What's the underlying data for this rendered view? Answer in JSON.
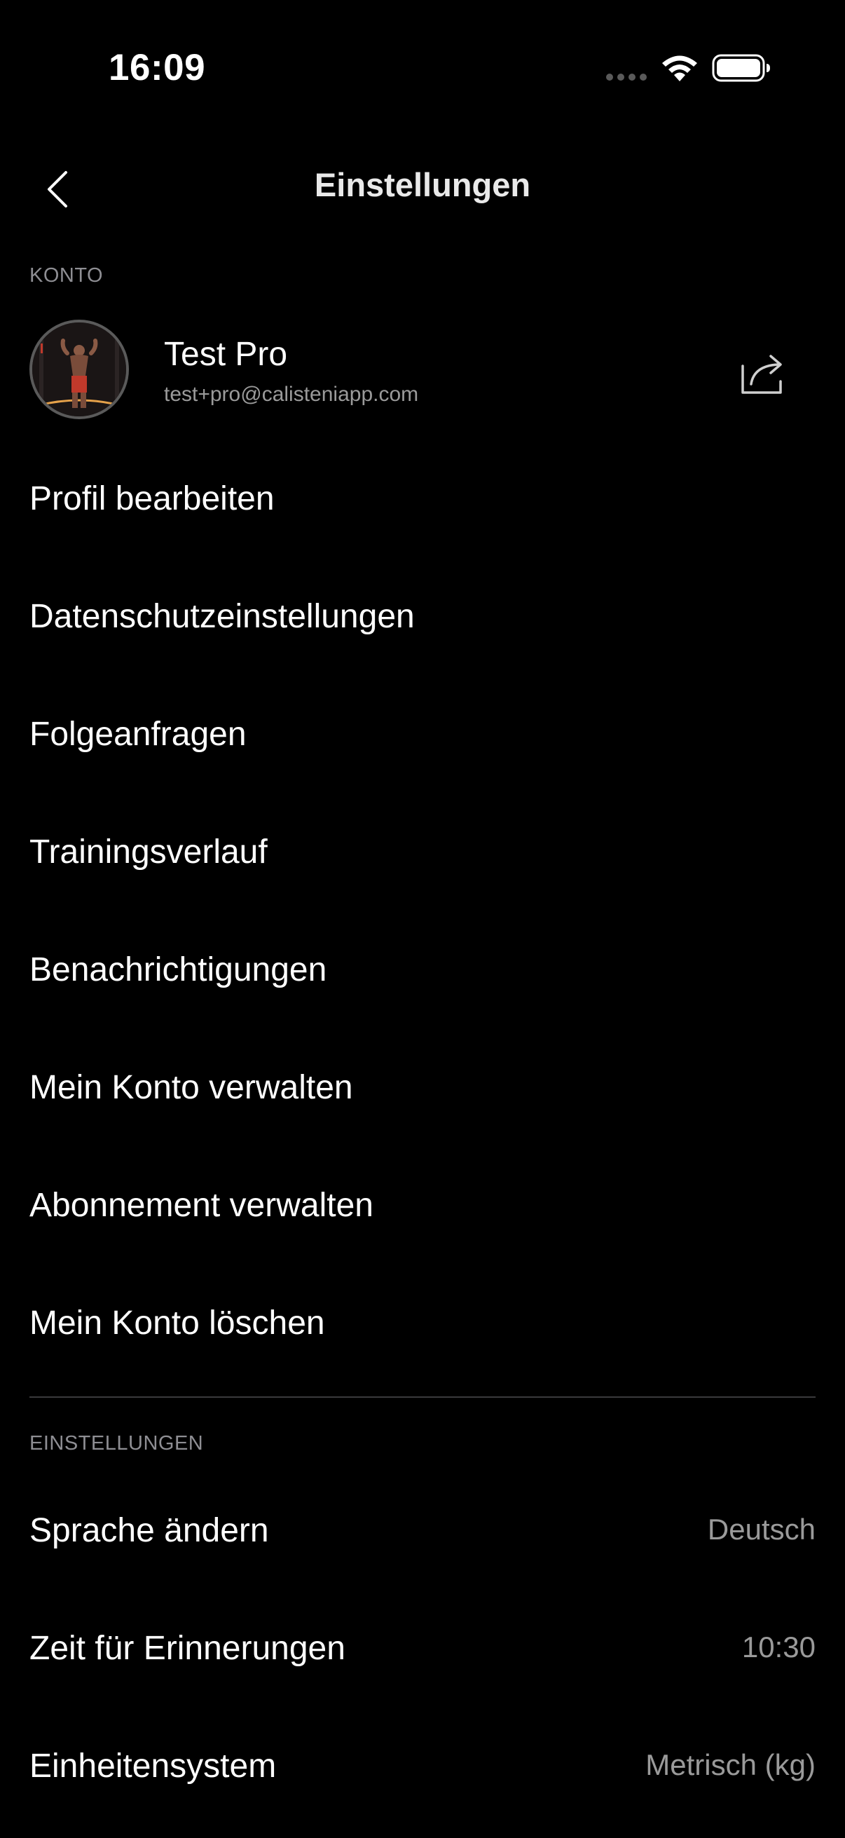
{
  "status_bar": {
    "time": "16:09"
  },
  "nav": {
    "title": "Einstellungen",
    "back_icon": "chevron-left-icon"
  },
  "account_section": {
    "label": "KONTO",
    "profile": {
      "name": "Test Pro",
      "email": "test+pro@calisteniapp.com",
      "share_icon": "share-icon"
    },
    "items": [
      {
        "label": "Profil bearbeiten"
      },
      {
        "label": "Datenschutzeinstellungen"
      },
      {
        "label": "Folgeanfragen"
      },
      {
        "label": "Trainingsverlauf"
      },
      {
        "label": "Benachrichtigungen"
      },
      {
        "label": "Mein Konto verwalten"
      },
      {
        "label": "Abonnement verwalten"
      },
      {
        "label": "Mein Konto löschen"
      }
    ]
  },
  "settings_section": {
    "label": "EINSTELLUNGEN",
    "items": [
      {
        "label": "Sprache ändern",
        "value": "Deutsch"
      },
      {
        "label": "Zeit für Erinnerungen",
        "value": "10:30"
      },
      {
        "label": "Einheitensystem",
        "value": "Metrisch (kg)"
      }
    ]
  },
  "colors": {
    "background": "#000000",
    "primary_text": "#ffffff",
    "secondary_text": "#9a9a9a",
    "section_label": "#8e8e93",
    "divider": "#3a3a3c"
  }
}
